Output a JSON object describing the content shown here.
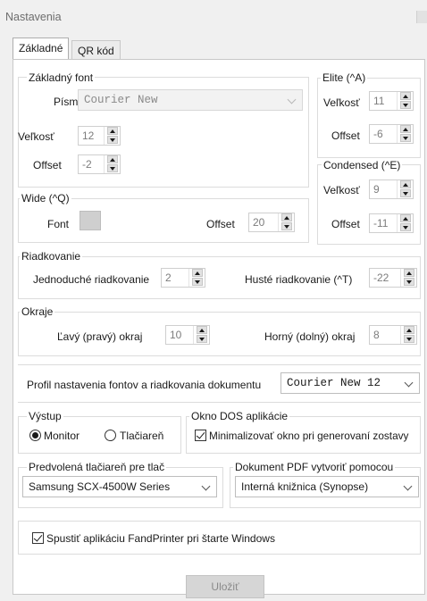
{
  "window": {
    "title": "Nastavenia"
  },
  "tabs": [
    {
      "label": "Základné",
      "active": true
    },
    {
      "label": "QR kód",
      "active": false
    }
  ],
  "basic_font": {
    "legend": "Základný font",
    "font_label": "Písmo",
    "font_value": "Courier New",
    "size_label": "Veľkosť",
    "size_value": "12",
    "offset_label": "Offset",
    "offset_value": "-2"
  },
  "elite": {
    "legend": "Elite (^A)",
    "size_label": "Veľkosť",
    "size_value": "11",
    "offset_label": "Offset",
    "offset_value": "-6"
  },
  "condensed": {
    "legend": "Condensed (^E)",
    "size_label": "Veľkosť",
    "size_value": "9",
    "offset_label": "Offset",
    "offset_value": "-11"
  },
  "wide": {
    "legend": "Wide (^Q)",
    "font_label": "Font",
    "offset_label": "Offset",
    "offset_value": "20"
  },
  "line_spacing": {
    "legend": "Riadkovanie",
    "single_label": "Jednoduché riadkovanie",
    "single_value": "2",
    "dense_label": "Husté riadkovanie (^T)",
    "dense_value": "-22"
  },
  "margins": {
    "legend": "Okraje",
    "left_label": "Ľavý (pravý) okraj",
    "left_value": "10",
    "top_label": "Horný (dolný) okraj",
    "top_value": "8"
  },
  "profile": {
    "label": "Profil nastavenia fontov a riadkovania dokumentu",
    "value": "Courier New 12"
  },
  "output": {
    "legend": "Výstup",
    "monitor_label": "Monitor",
    "printer_label": "Tlačiareň",
    "selected": "Monitor"
  },
  "dos_window": {
    "legend": "Okno DOS aplikácie",
    "minimize_label": "Minimalizovať okno pri generovaní zostavy",
    "minimize_checked": true
  },
  "default_printer": {
    "legend": "Predvolená tlačiareň pre tlač",
    "value": "Samsung SCX-4500W Series"
  },
  "pdf_document": {
    "legend": "Dokument PDF vytvoriť pomocou",
    "value": "Interná knižnica (Synopse)"
  },
  "startup": {
    "label": "Spustiť aplikáciu FandPrinter pri štarte Windows",
    "checked": true
  },
  "actions": {
    "save_label": "Uložiť"
  },
  "icons": {
    "spin_up": "spin-up-icon",
    "spin_down": "spin-down-icon",
    "dropdown": "chevron-down-icon"
  }
}
